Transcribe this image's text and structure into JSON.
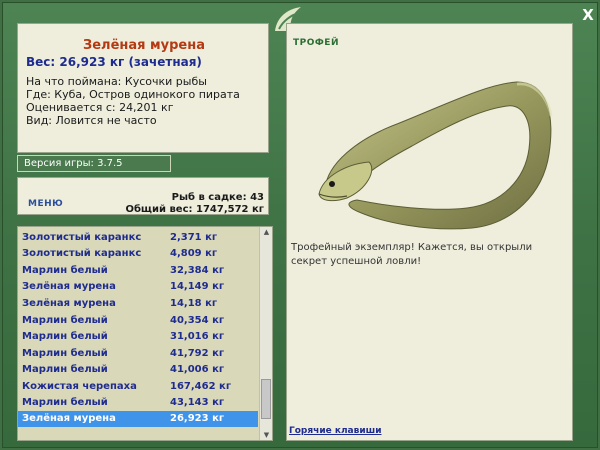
{
  "window": {
    "close_label": "X"
  },
  "fish": {
    "title": "Зелёная мурена",
    "weight": "Вес: 26,923 кг (зачетная)",
    "bait": "На что поймана: Кусочки рыбы",
    "location": "Где: Куба, Остров одинокого пирата",
    "value": "Оценивается с: 24,201 кг",
    "kind": "Вид: Ловится не часто"
  },
  "version": "Версия игры: 3.7.5",
  "menu": {
    "title": "МЕНЮ",
    "fish_count": "Рыб в садке: 43",
    "total_weight": "Общий вес: 1747,572 кг"
  },
  "catch_list": [
    {
      "name": "Золотистый каранкс",
      "weight": "2,371 кг"
    },
    {
      "name": "Золотистый каранкс",
      "weight": "4,809 кг"
    },
    {
      "name": "Марлин белый",
      "weight": "32,384 кг"
    },
    {
      "name": "Зелёная мурена",
      "weight": "14,149 кг"
    },
    {
      "name": "Зелёная мурена",
      "weight": "14,18 кг"
    },
    {
      "name": "Марлин белый",
      "weight": "40,354 кг"
    },
    {
      "name": "Марлин белый",
      "weight": "31,016 кг"
    },
    {
      "name": "Марлин белый",
      "weight": "41,792 кг"
    },
    {
      "name": "Марлин белый",
      "weight": "41,006 кг"
    },
    {
      "name": "Кожистая черепаха",
      "weight": "167,462 кг"
    },
    {
      "name": "Марлин белый",
      "weight": "43,143 кг"
    },
    {
      "name": "Зелёная мурена",
      "weight": "26,923 кг",
      "selected": true
    }
  ],
  "trophy": {
    "tab": "ТРОФЕЙ",
    "message": "Трофейный экземпляр! Кажется, вы открыли секрет успешной ловли!",
    "hotkeys": "Горячие клавиши"
  },
  "icons": {
    "close": "close-icon",
    "logo": "logo-icon",
    "fish": "moray-eel-image",
    "scroll_up": "scroll-up-icon",
    "scroll_down": "scroll-down-icon"
  },
  "colors": {
    "frame": "#3f7346",
    "panel": "#efeedd",
    "list_bg": "#d9d8b8",
    "selected": "#3f94e9",
    "title": "#b33a12",
    "text_blue": "#1f2c8f"
  }
}
